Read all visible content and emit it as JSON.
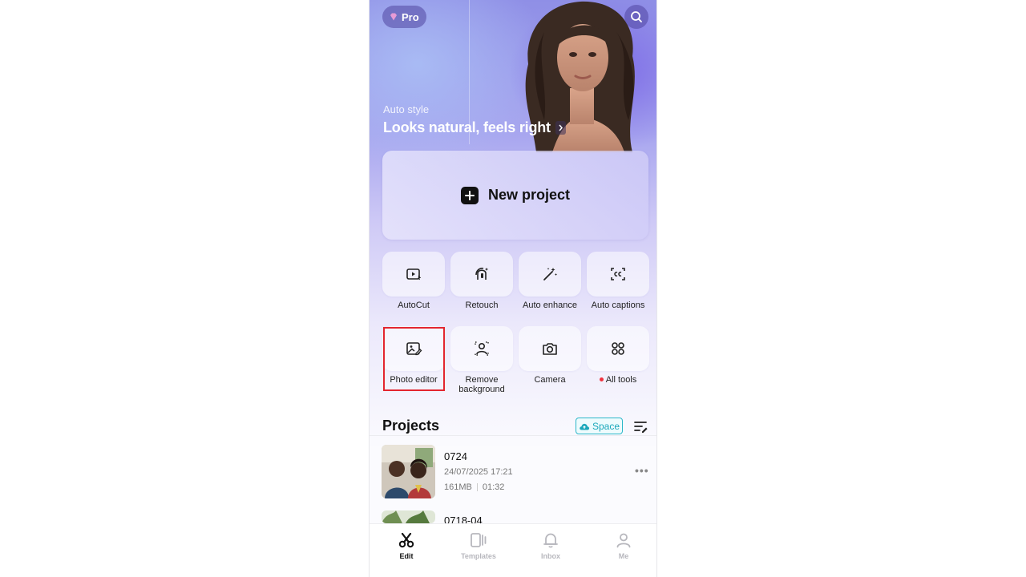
{
  "header": {
    "pro_label": "Pro",
    "search_icon": "search-icon"
  },
  "hero": {
    "subtitle": "Auto style",
    "headline": "Looks natural, feels right"
  },
  "new_project": {
    "label": "New project"
  },
  "tools_row1": [
    {
      "label": "AutoCut",
      "icon": "autocut-icon"
    },
    {
      "label": "Retouch",
      "icon": "retouch-icon"
    },
    {
      "label": "Auto enhance",
      "icon": "magic-wand-icon"
    },
    {
      "label": "Auto captions",
      "icon": "captions-icon"
    }
  ],
  "tools_row2": [
    {
      "label": "Photo editor",
      "icon": "photo-edit-icon"
    },
    {
      "label": "Remove background",
      "icon": "remove-bg-icon"
    },
    {
      "label": "Camera",
      "icon": "camera-icon"
    },
    {
      "label": "All tools",
      "icon": "grid-icon"
    }
  ],
  "projects": {
    "title": "Projects",
    "space_label": "Space",
    "items": [
      {
        "name": "0724",
        "date": "24/07/2025 17:21",
        "size": "161MB",
        "duration": "01:32"
      },
      {
        "name": "0718-04"
      }
    ]
  },
  "bottom_nav": [
    {
      "label": "Edit",
      "icon": "scissors-icon",
      "active": true
    },
    {
      "label": "Templates",
      "icon": "templates-icon"
    },
    {
      "label": "Inbox",
      "icon": "bell-icon"
    },
    {
      "label": "Me",
      "icon": "person-icon"
    }
  ],
  "colors": {
    "accent_highlight": "#e3262f",
    "space_chip": "#2bb7c9",
    "notification_dot": "#f0323e"
  }
}
